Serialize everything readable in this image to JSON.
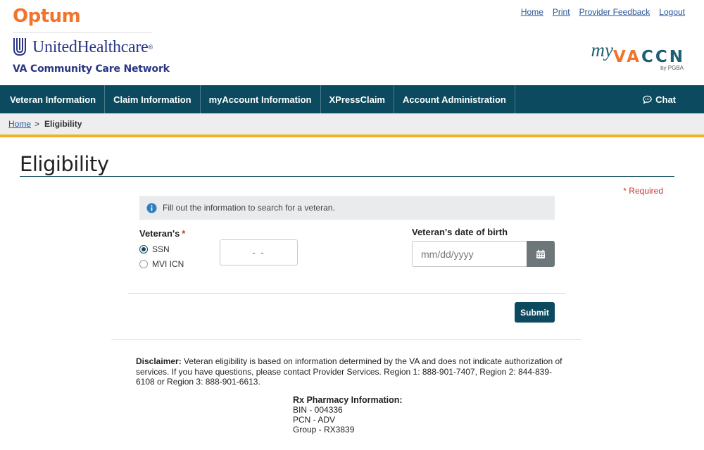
{
  "header": {
    "optum_logo": "Optum",
    "uhc_logo": "UnitedHealthcare",
    "uhc_reg": "®",
    "network_name": "VA Community Care Network",
    "top_links": [
      "Home",
      "Print",
      "Provider Feedback",
      "Logout"
    ],
    "brand": {
      "my": "my",
      "va": "VA",
      "ccn": "CCN",
      "by": "by PGBA"
    }
  },
  "nav": {
    "items": [
      "Veteran Information",
      "Claim Information",
      "myAccount Information",
      "XPressClaim",
      "Account Administration"
    ],
    "chat": "Chat"
  },
  "breadcrumb": {
    "home": "Home",
    "separator": ">",
    "current": "Eligibility"
  },
  "page": {
    "title": "Eligibility",
    "required_note": "* Required",
    "info_text": "Fill out the information to search for a veteran."
  },
  "form": {
    "id_label": "Veteran's",
    "required_marker": "*",
    "options": [
      "SSN",
      "MVI ICN"
    ],
    "selected_option": "SSN",
    "ssn_mask": "-  -",
    "dob_label": "Veteran's date of birth",
    "dob_placeholder": "mm/dd/yyyy",
    "submit": "Submit"
  },
  "disclaimer": {
    "label": "Disclaimer:",
    "text": "Veteran eligibility is based on information determined by the VA and does not indicate authorization of services. If you have questions, please contact Provider Services. Region 1: 888-901-7407, Region 2: 844-839-6108 or Region 3: 888-901-6613."
  },
  "rx": {
    "title": "Rx Pharmacy Information:",
    "bin": "BIN - 004336",
    "pcn": "PCN - ADV",
    "group": "Group - RX3839"
  },
  "colors": {
    "brand_teal": "#0b4a5f",
    "optum_orange": "#f2742c",
    "uhc_blue": "#2a3684",
    "gold_bar": "#f0b323",
    "required_red": "#c0392b"
  }
}
